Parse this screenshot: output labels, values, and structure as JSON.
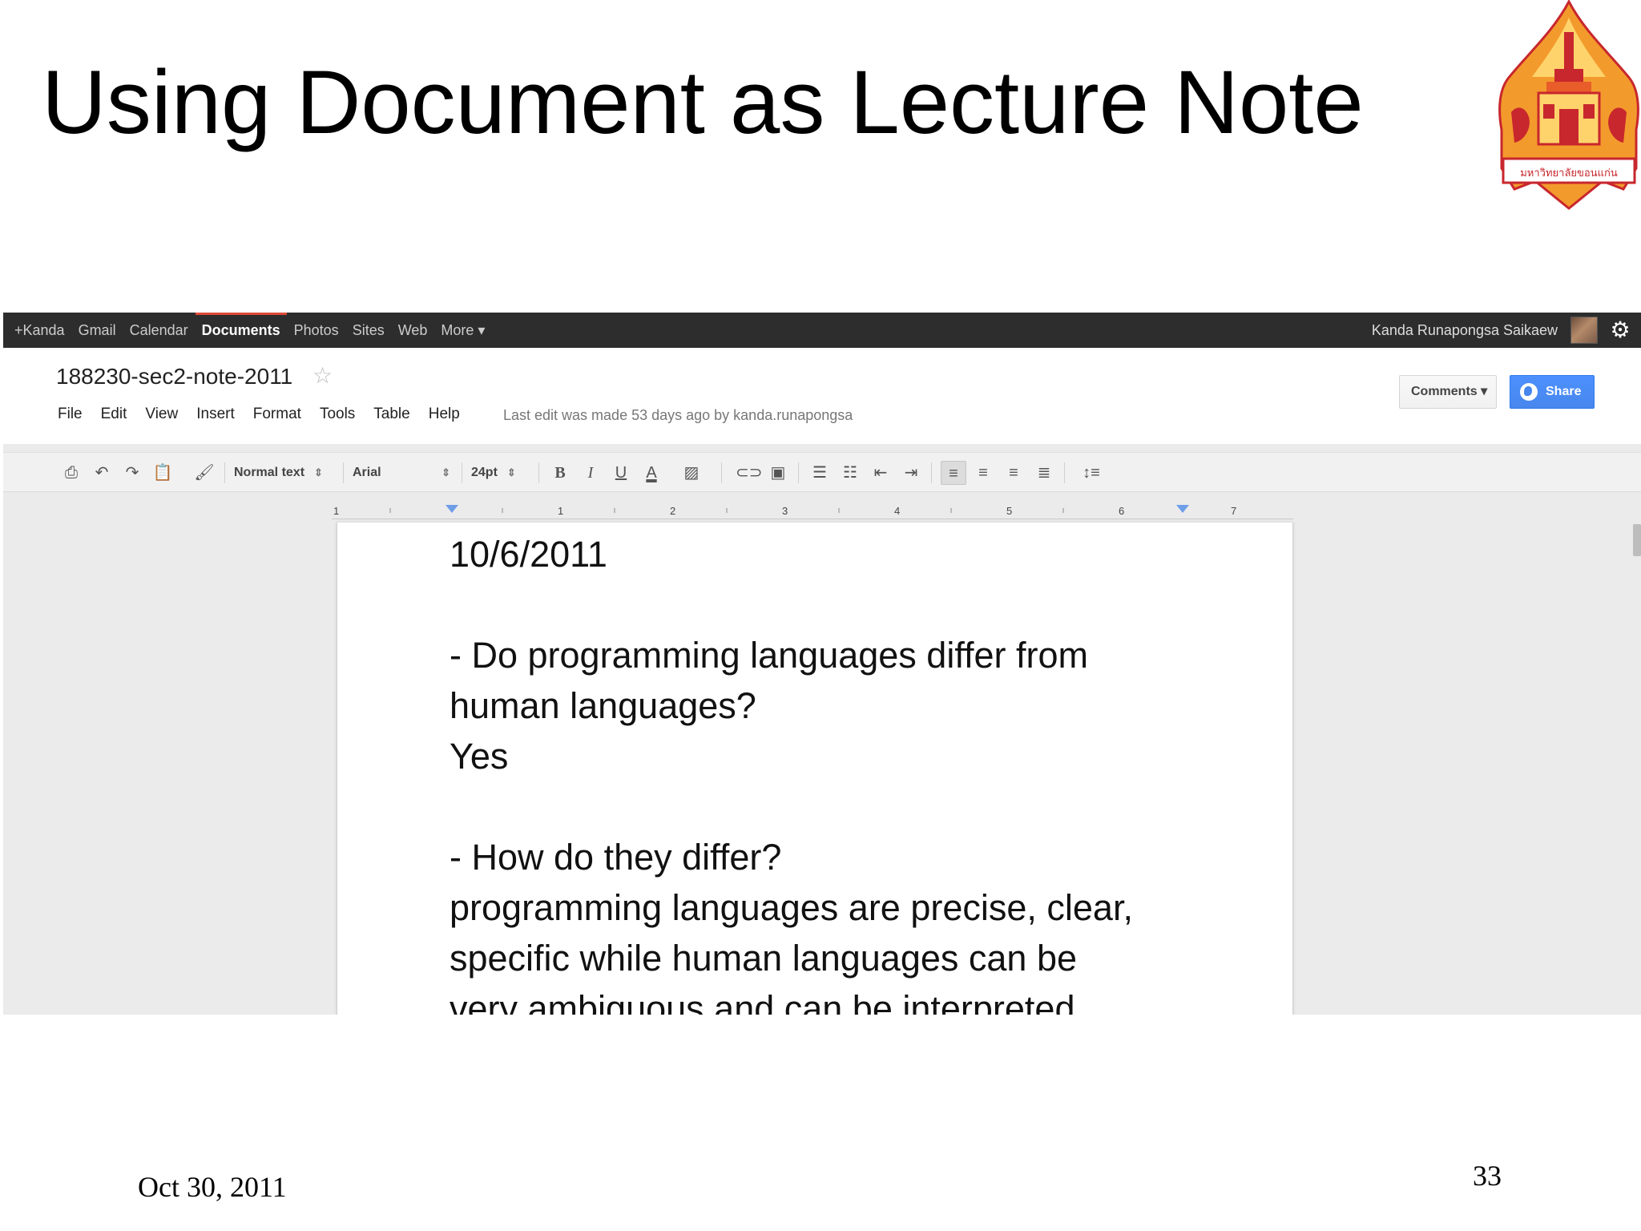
{
  "slide": {
    "title": "Using Document as Lecture Note",
    "footer_date": "Oct 30, 2011",
    "page_number": "33",
    "logo_label": "มหาวิทยาลัยขอนแก่น"
  },
  "gbar": {
    "nav": [
      "+Kanda",
      "Gmail",
      "Calendar",
      "Documents",
      "Photos",
      "Sites",
      "Web",
      "More ▾"
    ],
    "active": "Documents",
    "user_name": "Kanda Runapongsa Saikaew"
  },
  "doc": {
    "title": "188230-sec2-note-2011",
    "menu": [
      "File",
      "Edit",
      "View",
      "Insert",
      "Format",
      "Tools",
      "Table",
      "Help"
    ],
    "last_edit": "Last edit was made 53 days ago by kanda.runapongsa",
    "comments_label": "Comments ▾",
    "share_label": "Share"
  },
  "toolbar": {
    "style": "Normal text",
    "font": "Arial",
    "size": "24pt"
  },
  "ruler": [
    "1",
    "1",
    "2",
    "3",
    "4",
    "5",
    "6",
    "7"
  ],
  "body": {
    "lines": [
      "10/6/2011",
      "",
      "- Do programming languages differ from",
      "human languages?",
      "Yes",
      "",
      "- How do they differ?",
      "programming languages are precise, clear,",
      "specific while human languages can be",
      "very ambiguous and can be interpreted"
    ]
  },
  "colors": {
    "gbar_bg": "#2d2d2d",
    "active_tab_accent": "#dd4b39",
    "share_button": "#4787ed",
    "logo_orange": "#f39a2c",
    "logo_red": "#c8272d"
  }
}
